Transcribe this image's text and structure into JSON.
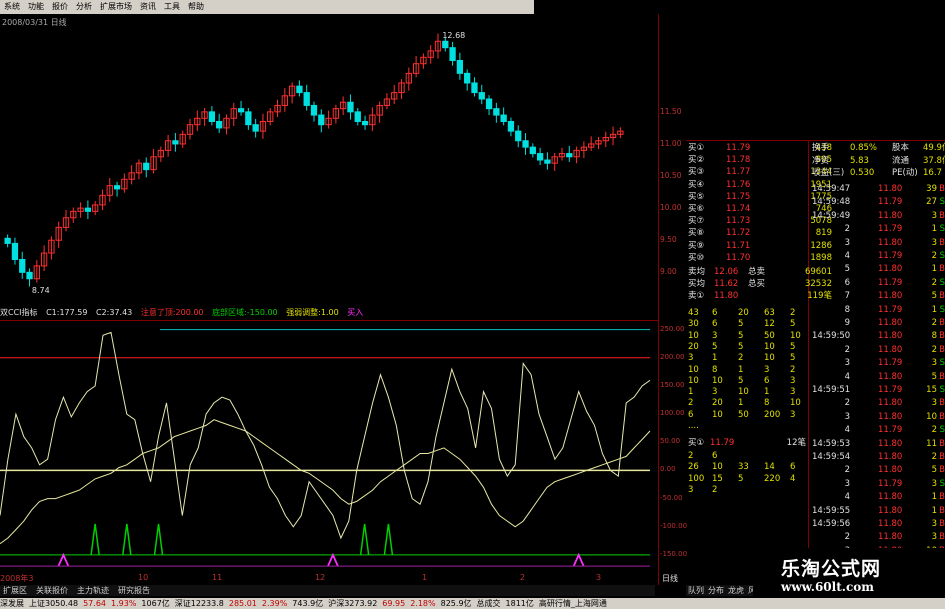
{
  "menu": [
    "系统",
    "功能",
    "报价",
    "分析",
    "扩展市场",
    "资讯",
    "工具",
    "帮助"
  ],
  "chart_title": "2008/03/31 日线",
  "price_chart": {
    "y_ticks": [
      "11.50",
      "11.00",
      "10.50",
      "10.00",
      "9.50",
      "9.00"
    ],
    "high_label": "12.68",
    "low_label": "8.74",
    "x_labels": [
      "2008年3",
      "10",
      "11",
      "12",
      "1",
      "2",
      "3"
    ]
  },
  "indicator": {
    "name": "双CCI指标",
    "c1": "C1:177.59",
    "c2": "C2:37.43",
    "danger": "注意了顶:200.00",
    "bottom": "底部区域:-150.00",
    "strong": "强弱调整:1.00",
    "buy": "买入",
    "y_ticks": [
      "250.00",
      "200.00",
      "150.00",
      "100.00",
      "50.00",
      "0.00",
      "-50.00",
      "-100.00",
      "-150.00"
    ]
  },
  "chart_data": {
    "type": "line",
    "xlabel": "",
    "ylabel": "",
    "title": "",
    "ylim": [
      -175,
      260
    ],
    "x_ticks": [
      "2008年3",
      "10",
      "11",
      "12",
      "1",
      "2",
      "3"
    ],
    "reference_lines": [
      200,
      0,
      -150
    ],
    "series": [
      {
        "name": "C1",
        "values": [
          -80,
          20,
          100,
          60,
          40,
          10,
          20,
          90,
          130,
          95,
          120,
          140,
          150,
          240,
          245,
          170,
          100,
          90,
          30,
          -20,
          60,
          120,
          20,
          -80,
          10,
          40,
          100,
          120,
          130,
          125,
          100,
          70,
          45,
          10,
          -30,
          -50,
          -80,
          -100,
          -80,
          -20,
          -40,
          -60,
          -80,
          -120,
          -90,
          0,
          60,
          120,
          170,
          130,
          80,
          0,
          -50,
          -60,
          -20,
          60,
          120,
          180,
          140,
          110,
          40,
          140,
          110,
          20,
          -10,
          10,
          190,
          170,
          100,
          60,
          20,
          40,
          90,
          140,
          105,
          80,
          30,
          0,
          -10,
          120,
          130,
          150,
          160
        ]
      },
      {
        "name": "C2",
        "values": [
          -130,
          -120,
          -105,
          -90,
          -70,
          -55,
          -50,
          -50,
          -45,
          -40,
          -35,
          -25,
          -15,
          -10,
          -5,
          5,
          10,
          20,
          30,
          35,
          40,
          50,
          60,
          65,
          70,
          75,
          80,
          90,
          85,
          80,
          75,
          70,
          60,
          50,
          40,
          30,
          20,
          10,
          0,
          -5,
          -15,
          -25,
          -35,
          -50,
          -60,
          -55,
          -45,
          -35,
          -20,
          -10,
          0,
          10,
          20,
          30,
          30,
          35,
          40,
          30,
          20,
          5,
          -10,
          -30,
          -60,
          -80,
          -90,
          -100,
          -90,
          -70,
          -50,
          -30,
          -20,
          -15,
          -10,
          -5,
          0,
          5,
          10,
          15,
          20,
          25,
          40,
          55,
          70
        ]
      }
    ],
    "signals_green": [
      12,
      16,
      20,
      46,
      49,
      93,
      96
    ],
    "signals_magenta": [
      8,
      42,
      73,
      89
    ]
  },
  "quotes": {
    "sell_labels": [
      "卖⑤",
      "卖④",
      "卖③",
      "卖②",
      "卖①"
    ],
    "top_rows": [
      {
        "label": "买①",
        "price": "11.79",
        "vol": "438"
      },
      {
        "label": "买②",
        "price": "11.78",
        "vol": "895"
      },
      {
        "label": "买③",
        "price": "11.77",
        "vol": "1344"
      },
      {
        "label": "买④",
        "price": "11.76",
        "vol": "1951"
      },
      {
        "label": "买⑤",
        "price": "11.75",
        "vol": "1775"
      },
      {
        "label": "买⑥",
        "price": "11.74",
        "vol": "746"
      },
      {
        "label": "买⑦",
        "price": "11.73",
        "vol": "5078"
      },
      {
        "label": "买⑧",
        "price": "11.72",
        "vol": "819"
      },
      {
        "label": "买⑨",
        "price": "11.71",
        "vol": "1286"
      },
      {
        "label": "买⑩",
        "price": "11.70",
        "vol": "1898"
      }
    ],
    "avg_rows": [
      {
        "label": "卖均",
        "price": "12.06",
        "label2": "总卖",
        "vol": "69601"
      },
      {
        "label": "买均",
        "price": "11.62",
        "label2": "总买",
        "vol": "32532"
      },
      {
        "label": "卖①",
        "price": "11.80",
        "label2": "",
        "vol": "119笔"
      }
    ],
    "queue_sell": [
      [
        "43",
        "6",
        "20",
        "63",
        "2"
      ],
      [
        "30",
        "6",
        "5",
        "12",
        "5"
      ],
      [
        "10",
        "3",
        "5",
        "50",
        "10"
      ],
      [
        "20",
        "5",
        "5",
        "10",
        "5"
      ],
      [
        "3",
        "1",
        "2",
        "10",
        "5"
      ],
      [
        "10",
        "8",
        "1",
        "3",
        "2"
      ],
      [
        "10",
        "10",
        "5",
        "6",
        "3"
      ],
      [
        "1",
        "3",
        "10",
        "1",
        "3"
      ],
      [
        "2",
        "20",
        "1",
        "8",
        "10"
      ],
      [
        "6",
        "10",
        "50",
        "200",
        "3"
      ],
      [
        "....",
        "",
        "",
        "",
        ""
      ]
    ],
    "buy1": {
      "label": "买①",
      "price": "11.79",
      "count": "12笔"
    },
    "queue_buy": [
      [
        "2",
        "6",
        "",
        "",
        ""
      ],
      [
        "26",
        "10",
        "33",
        "14",
        "6"
      ],
      [
        "100",
        "15",
        "5",
        "220",
        "4"
      ],
      [
        "3",
        "2",
        "",
        "",
        ""
      ]
    ]
  },
  "stats": [
    {
      "k1": "换手",
      "v1": "0.85%",
      "k2": "股本",
      "v2": "49.9亿"
    },
    {
      "k1": "净资",
      "v1": "5.83",
      "k2": "流通",
      "v2": "37.8亿"
    },
    {
      "k1": "收益(三)",
      "v1": "0.530",
      "k2": "PE(动)",
      "v2": "16.7"
    }
  ],
  "ticks": [
    {
      "t": "14:59:47",
      "p": "11.80",
      "v": "39",
      "d": "B"
    },
    {
      "t": "14:59:48",
      "p": "11.79",
      "v": "27",
      "d": "S"
    },
    {
      "t": "14:59:49",
      "p": "11.80",
      "v": "3",
      "d": "B"
    },
    {
      "t": "2",
      "p": "11.79",
      "v": "1",
      "d": "S"
    },
    {
      "t": "3",
      "p": "11.80",
      "v": "3",
      "d": "B"
    },
    {
      "t": "4",
      "p": "11.79",
      "v": "2",
      "d": "S"
    },
    {
      "t": "5",
      "p": "11.80",
      "v": "1",
      "d": "B"
    },
    {
      "t": "6",
      "p": "11.79",
      "v": "2",
      "d": "S"
    },
    {
      "t": "7",
      "p": "11.80",
      "v": "5",
      "d": "B"
    },
    {
      "t": "8",
      "p": "11.79",
      "v": "1",
      "d": "S"
    },
    {
      "t": "9",
      "p": "11.80",
      "v": "2",
      "d": "B"
    },
    {
      "t": "14:59:50",
      "p": "11.80",
      "v": "8",
      "d": "B"
    },
    {
      "t": "2",
      "p": "11.80",
      "v": "2",
      "d": "B"
    },
    {
      "t": "3",
      "p": "11.79",
      "v": "3",
      "d": "S"
    },
    {
      "t": "4",
      "p": "11.80",
      "v": "5",
      "d": "B"
    },
    {
      "t": "14:59:51",
      "p": "11.79",
      "v": "15",
      "d": "S"
    },
    {
      "t": "2",
      "p": "11.80",
      "v": "3",
      "d": "B"
    },
    {
      "t": "3",
      "p": "11.80",
      "v": "10",
      "d": "B"
    },
    {
      "t": "4",
      "p": "11.79",
      "v": "2",
      "d": "S"
    },
    {
      "t": "14:59:53",
      "p": "11.80",
      "v": "11",
      "d": "B"
    },
    {
      "t": "14:59:54",
      "p": "11.80",
      "v": "2",
      "d": "B"
    },
    {
      "t": "2",
      "p": "11.80",
      "v": "5",
      "d": "B"
    },
    {
      "t": "3",
      "p": "11.79",
      "v": "3",
      "d": "S"
    },
    {
      "t": "4",
      "p": "11.80",
      "v": "1",
      "d": "B"
    },
    {
      "t": "14:59:55",
      "p": "11.80",
      "v": "1",
      "d": "B"
    },
    {
      "t": "14:59:56",
      "p": "11.80",
      "v": "3",
      "d": "B"
    },
    {
      "t": "2",
      "p": "11.80",
      "v": "3",
      "d": "B"
    },
    {
      "t": "3",
      "p": "11.80",
      "v": "10",
      "d": "B"
    },
    {
      "t": "14:59:59",
      "p": "11.80",
      "v": "",
      "d": ""
    }
  ],
  "bottom_tabs": [
    "扩展区",
    "关联报价",
    "主力轨迹",
    "研究报告"
  ],
  "chart_tab": "日线",
  "right_tabs": [
    "队列",
    "分布",
    "龙虎",
    "风向"
  ],
  "status": [
    "深发展",
    "上证3050.48",
    "57.64",
    "1.93%",
    "1067亿",
    "深证12233.8",
    "285.01",
    "2.39%",
    "743.9亿",
    "沪深3273.92",
    "69.95",
    "2.18%",
    "825.9亿",
    "总成交",
    "1811亿",
    "高研行情_上海网通"
  ],
  "watermark": {
    "title": "乐淘公式网",
    "url": "www.60lt.com"
  },
  "colors": {
    "up": "#ff3030",
    "down": "#00e0e0",
    "c1": "#e8e8b0",
    "c2": "#e8e8a0",
    "danger_line": "#ff2020",
    "zero_line": "#e8e8a0",
    "bottom_line": "#00d000",
    "buy_signal": "#ff30ff",
    "green_signal": "#00d000"
  }
}
